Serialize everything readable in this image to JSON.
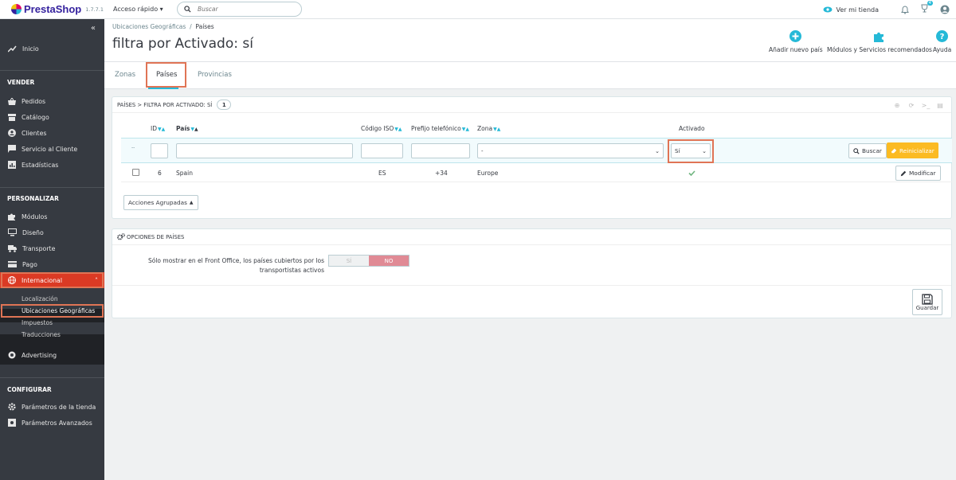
{
  "header": {
    "logo": "PrestaShop",
    "version": "1.7.7.1",
    "quick_access": "Acceso rápido",
    "search_placeholder": "Buscar",
    "view_store": "Ver mi tienda",
    "cart_badge": "4"
  },
  "sidebar": {
    "home": "Inicio",
    "sections": [
      {
        "title": "VENDER",
        "items": [
          "Pedidos",
          "Catálogo",
          "Clientes",
          "Servicio al Cliente",
          "Estadísticas"
        ]
      },
      {
        "title": "PERSONALIZAR",
        "items": [
          "Módulos",
          "Diseño",
          "Transporte",
          "Pago",
          "Internacional"
        ]
      },
      {
        "title": "CONFIGURAR",
        "items": [
          "Parámetros de la tienda",
          "Parámetros Avanzados"
        ]
      }
    ],
    "submenu": [
      "Localización",
      "Ubicaciones Geográficas",
      "Impuestos",
      "Traducciones"
    ],
    "advertising": "Advertising"
  },
  "page": {
    "breadcrumb_parent": "Ubicaciones Geográficas",
    "breadcrumb_current": "Países",
    "title": "filtra por Activado: sí",
    "toolbar": {
      "add": "Añadir nuevo país",
      "modules": "Módulos y Servicios recomendados",
      "help": "Ayuda"
    },
    "tabs": [
      "Zonas",
      "Países",
      "Provincias"
    ]
  },
  "list": {
    "heading": "PAÍSES > FILTRA POR ACTIVADO: SÍ",
    "count": "1",
    "columns": {
      "id": "ID",
      "country": "País",
      "iso": "Código ISO",
      "prefix": "Prefijo telefónico",
      "zone": "Zona",
      "active": "Activado"
    },
    "filter": {
      "dash": "--",
      "zone_value": "-",
      "active_value": "Sí"
    },
    "search_btn": "Buscar",
    "reset_btn": "Reinicializar",
    "rows": [
      {
        "id": "6",
        "country": "Spain",
        "iso": "ES",
        "prefix": "+34",
        "zone": "Europe"
      }
    ],
    "edit_btn": "Modificar",
    "bulk_btn": "Acciones Agrupadas"
  },
  "options": {
    "heading": "OPCIONES DE PAÍSES",
    "label": "Sólo mostrar en el Front Office, los países cubiertos por los transportistas activos",
    "yes": "SÍ",
    "no": "NO",
    "save": "Guardar"
  },
  "colors": {
    "sidebar": "#363a41",
    "accent": "#25b9d7",
    "highlight": "#e07455",
    "warning": "#fbbb22"
  }
}
